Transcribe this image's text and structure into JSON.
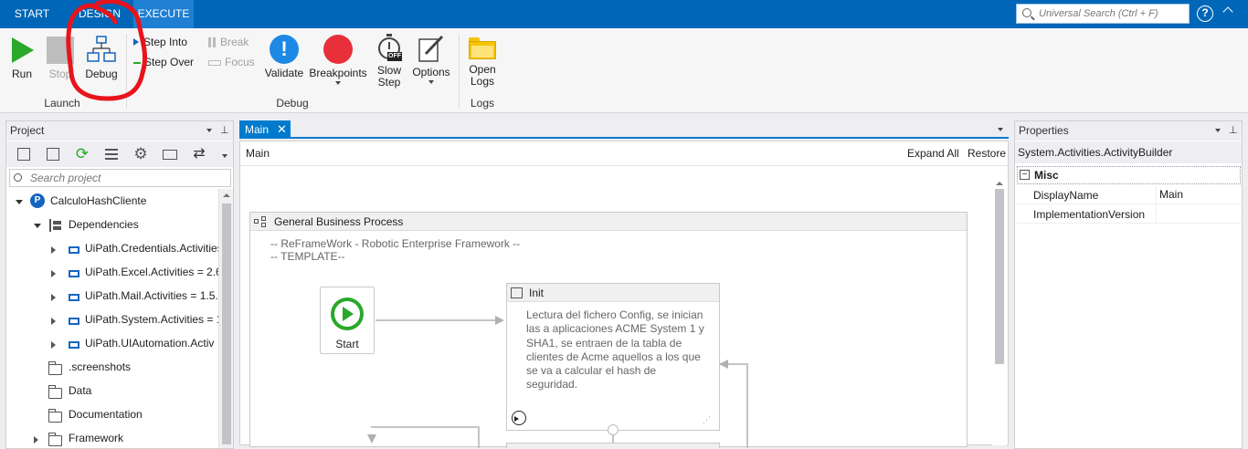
{
  "tabs": {
    "start": "START",
    "design": "DESIGN",
    "execute": "EXECUTE"
  },
  "search": {
    "placeholder": "Universal Search (Ctrl + F)"
  },
  "ribbon": {
    "run": "Run",
    "stop": "Stop",
    "debug": "Debug",
    "step_into": "Step Into",
    "step_over": "Step Over",
    "break": "Break",
    "focus": "Focus",
    "validate": "Validate",
    "breakpoints": "Breakpoints",
    "slow_step_1": "Slow",
    "slow_step_2": "Step",
    "slow_badge": "OFF",
    "options": "Options",
    "open_logs_1": "Open",
    "open_logs_2": "Logs",
    "groups": {
      "launch": "Launch",
      "debug": "Debug",
      "logs": "Logs"
    }
  },
  "project": {
    "title": "Project",
    "search_placeholder": "Search project",
    "tree": {
      "root": "CalculoHashCliente",
      "dependencies": "Dependencies",
      "deps": [
        "UiPath.Credentials.Activities",
        "UiPath.Excel.Activities = 2.6",
        "UiPath.Mail.Activities = 1.5.",
        "UiPath.System.Activities = 1",
        "UiPath.UIAutomation.Activ"
      ],
      "folders": [
        ".screenshots",
        "Data",
        "Documentation",
        "Framework"
      ]
    }
  },
  "designer": {
    "tab_label": "Main",
    "breadcrumb": "Main",
    "expand_all": "Expand All",
    "restore": "Restore",
    "gbp_title": "General Business Process",
    "annotation_1": "-- ReFrameWork - Robotic Enterprise Framework --",
    "annotation_2": "-- TEMPLATE--",
    "start_label": "Start",
    "init_title": "Init",
    "init_desc": "Lectura del fichero Config, se inician las a aplicaciones ACME System 1 y SHA1, se entraen de la tabla de clientes de Acme aquellos a los que se va a calcular el hash de seguridad."
  },
  "properties": {
    "title": "Properties",
    "type": "System.Activities.ActivityBuilder",
    "category": "Misc",
    "rows": [
      {
        "name": "DisplayName",
        "value": "Main"
      },
      {
        "name": "ImplementationVersion",
        "value": ""
      }
    ]
  },
  "colors": {
    "topbar": "#0067b8",
    "accent": "#007acc",
    "run_green": "#2aa82a",
    "breakpoint_red": "#e8303a",
    "validate_blue": "#1e88e5",
    "folder_yellow": "#f5c400",
    "annotation_red": "#e8141c"
  }
}
